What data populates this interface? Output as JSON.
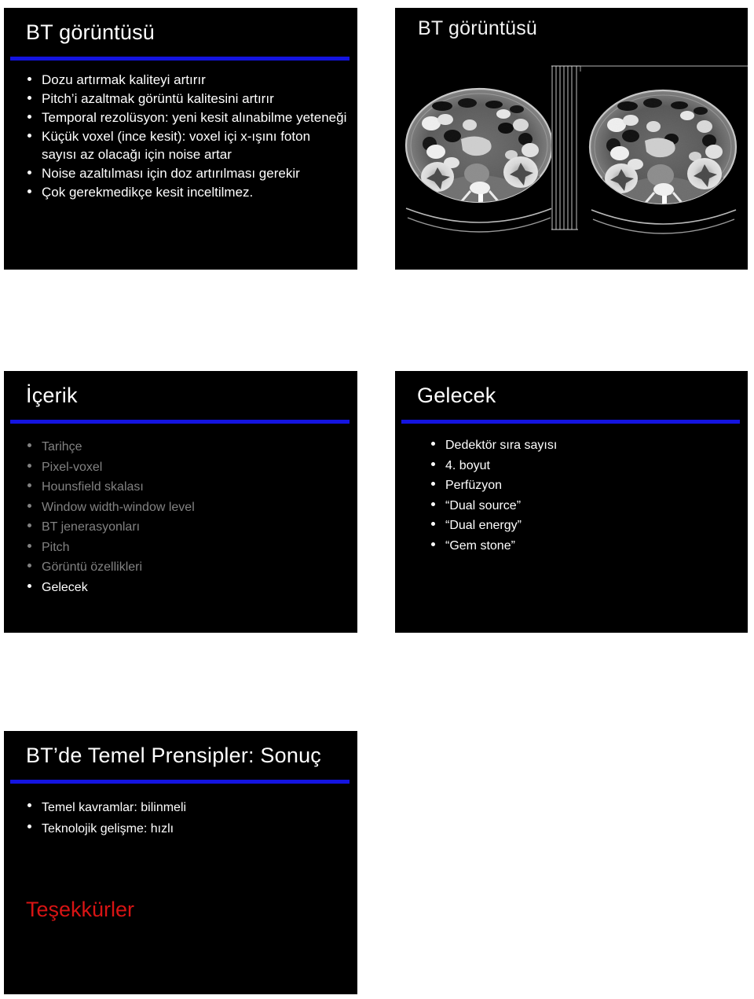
{
  "page": {
    "background": "#ffffff",
    "accent_rule_color": "#1414e0",
    "slide_background": "#000000",
    "body_text_color": "#ffffff",
    "dim_text_color": "#828282",
    "closing_text_color": "#d81414"
  },
  "slides": [
    {
      "id": "bt-goruntusu-text",
      "title": "BT görüntüsü",
      "has_rule": true,
      "bullets": [
        {
          "text": "Dozu artırmak kaliteyi artırır",
          "dim": false
        },
        {
          "text": "Pitch’i azaltmak görüntü kalitesini artırır",
          "dim": false
        },
        {
          "text": "Temporal rezolüsyon: yeni kesit alınabilme yeteneği",
          "dim": false
        },
        {
          "text": "Küçük voxel (ince kesit): voxel içi x-ışını foton sayısı az olacağı için noise artar",
          "dim": false
        },
        {
          "text": "Noise azaltılması için doz artırılması gerekir",
          "dim": false
        },
        {
          "text": "Çok gerekmedikçe kesit inceltilmez.",
          "dim": false
        }
      ]
    },
    {
      "id": "bt-goruntusu-image",
      "title": "BT görüntüsü",
      "has_rule": false,
      "figure": {
        "name": "abdominal-ct-axial-pair",
        "description": "Two axial abdominal CT slices side by side with thin vertical slice-position lines between them"
      },
      "bullets": []
    },
    {
      "id": "icerik",
      "title": "İçerik",
      "has_rule": true,
      "bullets": [
        {
          "text": "Tarihçe",
          "dim": true
        },
        {
          "text": "Pixel-voxel",
          "dim": true
        },
        {
          "text": "Hounsfield skalası",
          "dim": true
        },
        {
          "text": "Window width-window level",
          "dim": true
        },
        {
          "text": "BT jenerasyonları",
          "dim": true
        },
        {
          "text": "Pitch",
          "dim": true
        },
        {
          "text": "Görüntü özellikleri",
          "dim": true
        },
        {
          "text": "Gelecek",
          "dim": false
        }
      ]
    },
    {
      "id": "gelecek",
      "title": "Gelecek",
      "has_rule": true,
      "bullets": [
        {
          "text": "Dedektör sıra sayısı",
          "dim": false
        },
        {
          "text": "4. boyut",
          "dim": false
        },
        {
          "text": "Perfüzyon",
          "dim": false
        },
        {
          "text": "“Dual source”",
          "dim": false
        },
        {
          "text": "“Dual energy”",
          "dim": false
        },
        {
          "text": "“Gem stone”",
          "dim": false
        }
      ]
    },
    {
      "id": "sonuc",
      "title": "BT’de Temel Prensipler: Sonuç",
      "has_rule": true,
      "bullets": [
        {
          "text": "Temel kavramlar: bilinmeli",
          "dim": false
        },
        {
          "text": "Teknolojik gelişme: hızlı",
          "dim": false
        }
      ],
      "closing_text": "Teşekkürler"
    }
  ]
}
